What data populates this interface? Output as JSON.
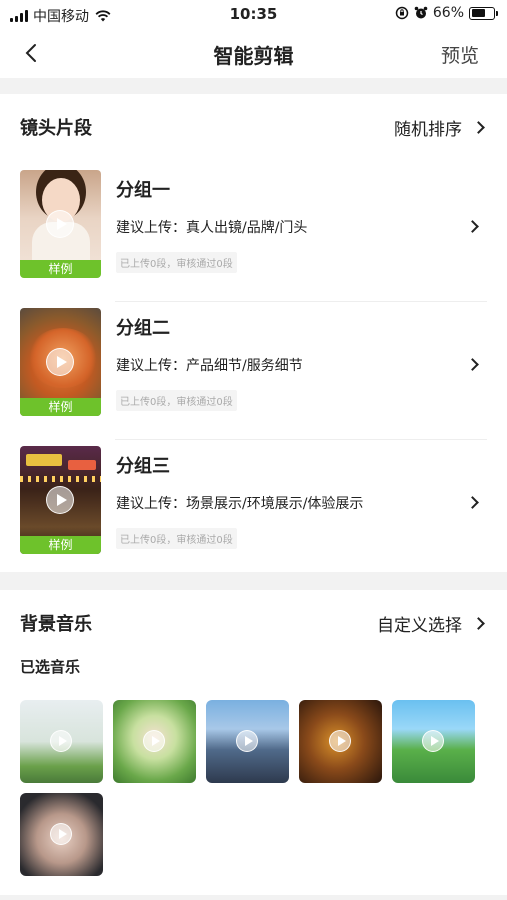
{
  "status_bar": {
    "carrier": "中国移动",
    "time": "10:35",
    "battery": "66%",
    "battery_level": 0.66,
    "icons": [
      "signal-icon",
      "wifi-icon",
      "lock-rotation-icon",
      "alarm-icon",
      "battery-icon"
    ]
  },
  "nav": {
    "back_icon": "chevron-left-icon",
    "title": "智能剪辑",
    "preview": "预览"
  },
  "clips": {
    "title": "镜头片段",
    "action": "随机排序",
    "groups": [
      {
        "name": "分组一",
        "suggestion": "建议上传：真人出镜/品牌/门头",
        "status": "已上传0段，审核通过0段",
        "sample": "样例"
      },
      {
        "name": "分组二",
        "suggestion": "建议上传：产品细节/服务细节",
        "status": "已上传0段，审核通过0段",
        "sample": "样例"
      },
      {
        "name": "分组三",
        "suggestion": "建议上传：场景展示/环境展示/体验展示",
        "status": "已上传0段，审核通过0段",
        "sample": "样例"
      }
    ]
  },
  "music": {
    "title": "背景音乐",
    "action": "自定义选择",
    "selected_label": "已选音乐",
    "tracks_count": 6
  },
  "colors": {
    "sample_badge": "#6ec22b",
    "background": "#f2f2f2"
  }
}
